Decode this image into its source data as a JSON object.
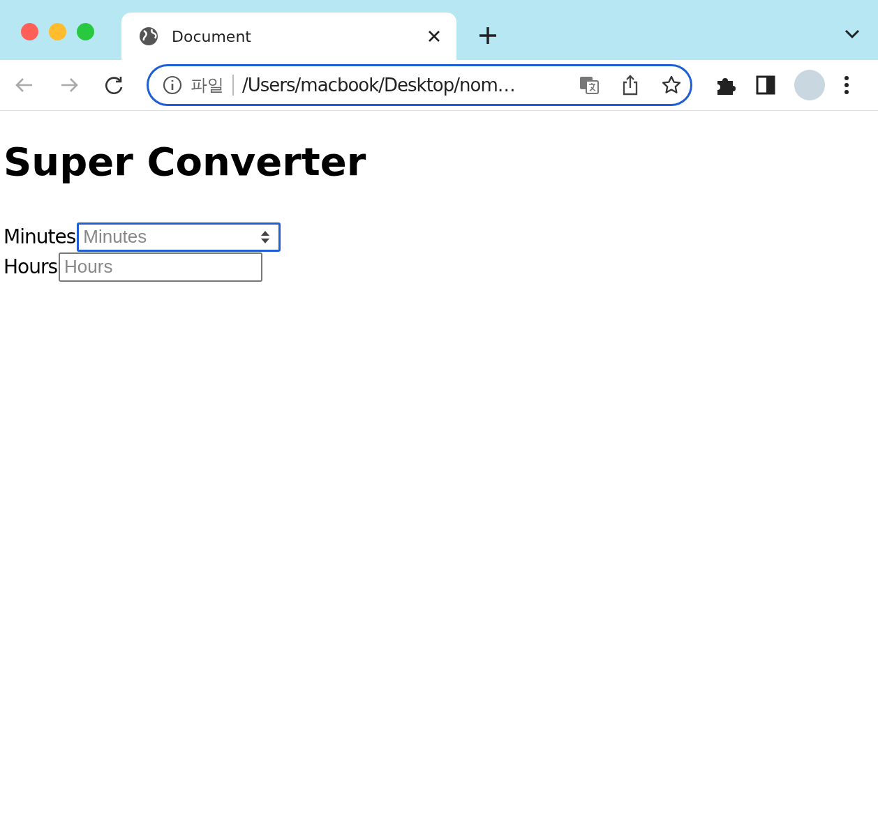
{
  "tabs": [
    {
      "title": "Document",
      "selected": true
    }
  ],
  "nav_buttons": [
    {
      "kind": "back",
      "disabled": true
    },
    {
      "kind": "forward",
      "disabled": true
    },
    {
      "kind": "reload",
      "disabled": false
    }
  ],
  "address_bar": {
    "scheme_label": "파일",
    "url": "/Users/macbook/Desktop/nom…",
    "focused": true
  },
  "page": {
    "heading": "Super Converter",
    "fields": [
      {
        "label": "Minutes",
        "placeholder": "Minutes",
        "kind": "number",
        "focused": true
      },
      {
        "label": "Hours",
        "placeholder": "Hours",
        "kind": "text",
        "focused": false
      }
    ]
  }
}
